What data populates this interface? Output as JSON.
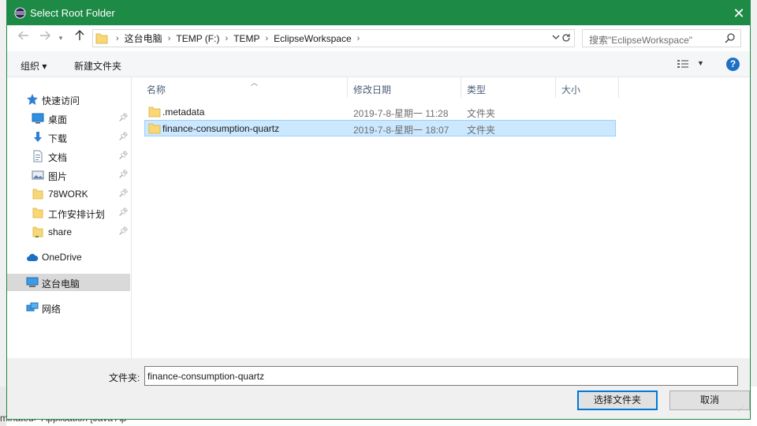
{
  "background_app": {
    "status_text": "minated> Application [Java Ap"
  },
  "dialog": {
    "title": "Select Root Folder",
    "close_label": "✕"
  },
  "nav": {
    "back_icon": "arrow-left-icon",
    "forward_icon": "arrow-right-icon",
    "up_icon": "arrow-up-icon",
    "breadcrumbs": [
      "这台电脑",
      "TEMP (F:)",
      "TEMP",
      "EclipseWorkspace"
    ],
    "search_placeholder": "搜索\"EclipseWorkspace\""
  },
  "toolbar": {
    "organize_label": "组织 ▾",
    "new_folder_label": "新建文件夹",
    "help_label": "?"
  },
  "sidebar": {
    "items": [
      {
        "label": "快速访问",
        "icon": "star-icon",
        "pinned": false
      },
      {
        "label": "桌面",
        "icon": "desktop-icon",
        "pinned": true
      },
      {
        "label": "下载",
        "icon": "download-icon",
        "pinned": true
      },
      {
        "label": "文档",
        "icon": "document-icon",
        "pinned": true
      },
      {
        "label": "图片",
        "icon": "pictures-icon",
        "pinned": true
      },
      {
        "label": "78WORK",
        "icon": "folder-icon",
        "pinned": true
      },
      {
        "label": "工作安排计划",
        "icon": "folder-icon",
        "pinned": true
      },
      {
        "label": "share",
        "icon": "shared-folder-icon",
        "pinned": true
      },
      {
        "label": "OneDrive",
        "icon": "cloud-icon",
        "pinned": false
      },
      {
        "label": "这台电脑",
        "icon": "computer-icon",
        "pinned": false,
        "selected": true
      },
      {
        "label": "网络",
        "icon": "network-icon",
        "pinned": false
      }
    ]
  },
  "files": {
    "columns": [
      "名称",
      "修改日期",
      "类型",
      "大小"
    ],
    "rows": [
      {
        "name": ".metadata",
        "date": "2019-7-8-星期一 11:28",
        "type": "文件夹",
        "size": "",
        "selected": false
      },
      {
        "name": "finance-consumption-quartz",
        "date": "2019-7-8-星期一 18:07",
        "type": "文件夹",
        "size": "",
        "selected": true
      }
    ]
  },
  "footer": {
    "folder_label": "文件夹:",
    "folder_value": "finance-consumption-quartz",
    "select_button": "选择文件夹",
    "cancel_button": "取消"
  },
  "colors": {
    "titlebar": "#1d8a45",
    "selection": "#cce8ff",
    "folder": "#f8d775",
    "accent": "#0078d7"
  }
}
